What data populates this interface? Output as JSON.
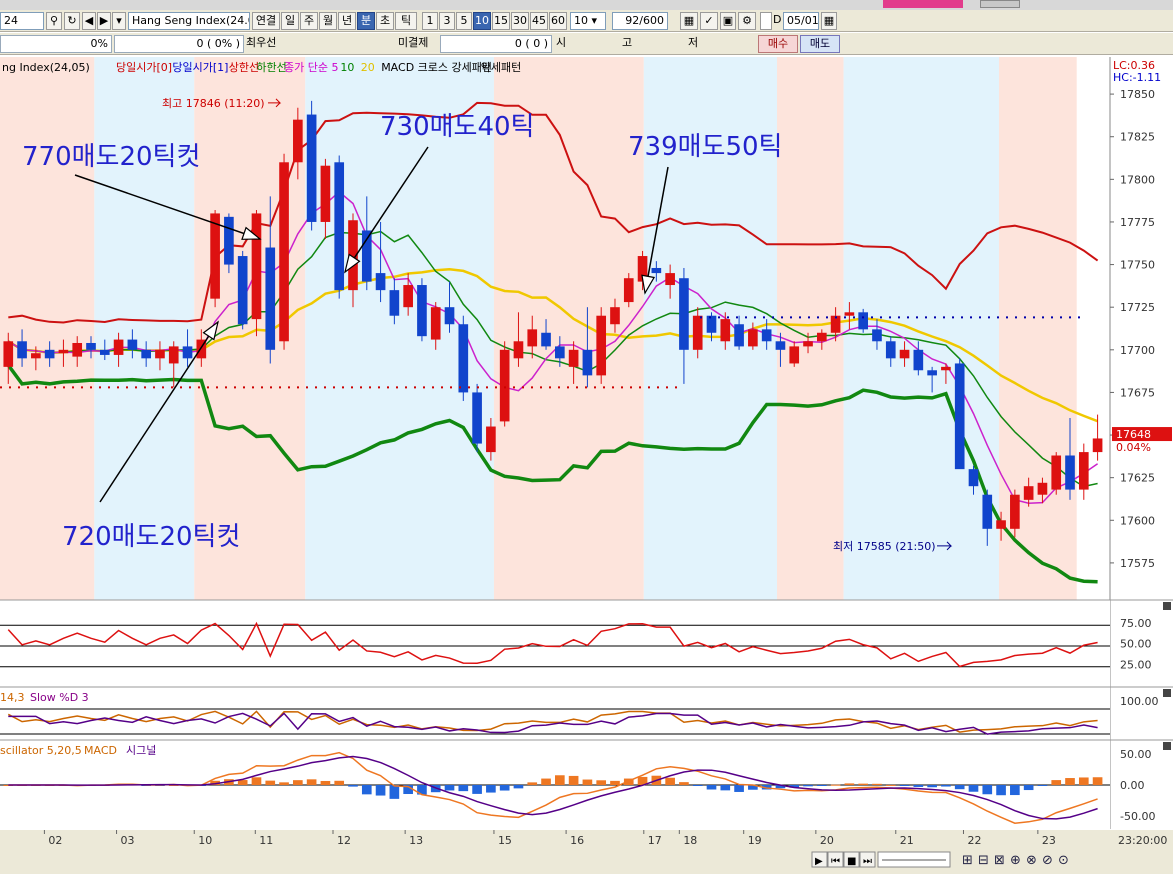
{
  "toolbar": {
    "code_value": "24",
    "symbol_value": "Hang Seng Index(24.0",
    "period_buttons": [
      "연결",
      "일",
      "주",
      "월",
      "년",
      "분",
      "초",
      "틱"
    ],
    "interval_buttons": [
      "1",
      "3",
      "5",
      "10",
      "15",
      "30",
      "45",
      "60"
    ],
    "interval_select": "10",
    "count_value": "92",
    "count_total": "/600",
    "d_label": "D",
    "date_value": "05/01"
  },
  "orderbar": {
    "pct1": "0%",
    "qty": "0",
    "pct2": "( 0% )",
    "best_label": "최우선",
    "unfilled_label": "미결제",
    "unfilled_qty": "0",
    "unfilled_paren": "( 0 )",
    "open_label": "시",
    "high_label": "고",
    "low_label": "저",
    "buy_label": "매수",
    "sell_label": "매도"
  },
  "chart_data": {
    "type": "candlestick",
    "legend": [
      {
        "text": "ng Index(24,05)",
        "color": "#000000"
      },
      {
        "text": "당일시가[0]",
        "color": "#cc0000"
      },
      {
        "text": "당일시가[1]",
        "color": "#0000cc"
      },
      {
        "text": "상한선",
        "color": "#cc0000"
      },
      {
        "text": "하한선",
        "color": "#008000"
      },
      {
        "text": "종가 단순 5",
        "color": "#cc00cc"
      },
      {
        "text": "10",
        "color": "#008000"
      },
      {
        "text": "20",
        "color": "#e0c000"
      },
      {
        "text": "MACD 크로스 강세패턴",
        "color": "#000000"
      },
      {
        "text": "약세패턴",
        "color": "#000000"
      }
    ],
    "lc_label": "LC:0.36",
    "hc_label": "HC:-1.11",
    "ylim": [
      17555,
      17870
    ],
    "yticks": [
      17850,
      17825,
      17800,
      17775,
      17750,
      17725,
      17700,
      17675,
      17650,
      17625,
      17600,
      17575
    ],
    "last_price": "17648",
    "last_change": "0.04%",
    "max_annotation": "최고 17846 (11:20)",
    "min_annotation": "최저 17585 (21:50)",
    "x_tick_labels": [
      "02",
      "03",
      "10",
      "11",
      "12",
      "13",
      "15",
      "16",
      "17",
      "18",
      "19",
      "20",
      "21",
      "22",
      "23"
    ],
    "x_end_label": "23:20:00",
    "callouts": [
      "770매도20틱컷",
      "730매도40틱",
      "739매도50틱",
      "720매도20틱컷"
    ],
    "candles": [
      {
        "o": 17690,
        "h": 17710,
        "l": 17680,
        "c": 17705
      },
      {
        "o": 17705,
        "h": 17712,
        "l": 17690,
        "c": 17695
      },
      {
        "o": 17695,
        "h": 17702,
        "l": 17688,
        "c": 17698
      },
      {
        "o": 17700,
        "h": 17705,
        "l": 17690,
        "c": 17695
      },
      {
        "o": 17698,
        "h": 17706,
        "l": 17690,
        "c": 17700
      },
      {
        "o": 17696,
        "h": 17708,
        "l": 17690,
        "c": 17704
      },
      {
        "o": 17704,
        "h": 17708,
        "l": 17695,
        "c": 17700
      },
      {
        "o": 17700,
        "h": 17706,
        "l": 17694,
        "c": 17697
      },
      {
        "o": 17697,
        "h": 17710,
        "l": 17690,
        "c": 17706
      },
      {
        "o": 17706,
        "h": 17712,
        "l": 17695,
        "c": 17700
      },
      {
        "o": 17700,
        "h": 17705,
        "l": 17690,
        "c": 17695
      },
      {
        "o": 17695,
        "h": 17705,
        "l": 17688,
        "c": 17700
      },
      {
        "o": 17692,
        "h": 17705,
        "l": 17678,
        "c": 17702
      },
      {
        "o": 17702,
        "h": 17712,
        "l": 17690,
        "c": 17695
      },
      {
        "o": 17695,
        "h": 17712,
        "l": 17690,
        "c": 17706
      },
      {
        "o": 17730,
        "h": 17782,
        "l": 17725,
        "c": 17780
      },
      {
        "o": 17778,
        "h": 17780,
        "l": 17745,
        "c": 17750
      },
      {
        "o": 17755,
        "h": 17758,
        "l": 17712,
        "c": 17715
      },
      {
        "o": 17718,
        "h": 17782,
        "l": 17708,
        "c": 17780
      },
      {
        "o": 17760,
        "h": 17790,
        "l": 17692,
        "c": 17700
      },
      {
        "o": 17705,
        "h": 17815,
        "l": 17700,
        "c": 17810
      },
      {
        "o": 17810,
        "h": 17842,
        "l": 17800,
        "c": 17835
      },
      {
        "o": 17838,
        "h": 17846,
        "l": 17770,
        "c": 17775
      },
      {
        "o": 17775,
        "h": 17812,
        "l": 17765,
        "c": 17808
      },
      {
        "o": 17810,
        "h": 17814,
        "l": 17730,
        "c": 17735
      },
      {
        "o": 17735,
        "h": 17780,
        "l": 17725,
        "c": 17776
      },
      {
        "o": 17770,
        "h": 17790,
        "l": 17735,
        "c": 17740
      },
      {
        "o": 17745,
        "h": 17775,
        "l": 17728,
        "c": 17735
      },
      {
        "o": 17735,
        "h": 17742,
        "l": 17715,
        "c": 17720
      },
      {
        "o": 17725,
        "h": 17745,
        "l": 17720,
        "c": 17738
      },
      {
        "o": 17738,
        "h": 17742,
        "l": 17705,
        "c": 17708
      },
      {
        "o": 17706,
        "h": 17728,
        "l": 17700,
        "c": 17725
      },
      {
        "o": 17725,
        "h": 17740,
        "l": 17710,
        "c": 17715
      },
      {
        "o": 17715,
        "h": 17720,
        "l": 17670,
        "c": 17675
      },
      {
        "o": 17675,
        "h": 17680,
        "l": 17640,
        "c": 17645
      },
      {
        "o": 17640,
        "h": 17660,
        "l": 17635,
        "c": 17655
      },
      {
        "o": 17658,
        "h": 17705,
        "l": 17655,
        "c": 17700
      },
      {
        "o": 17695,
        "h": 17722,
        "l": 17690,
        "c": 17705
      },
      {
        "o": 17702,
        "h": 17720,
        "l": 17695,
        "c": 17712
      },
      {
        "o": 17710,
        "h": 17718,
        "l": 17700,
        "c": 17702
      },
      {
        "o": 17702,
        "h": 17708,
        "l": 17690,
        "c": 17695
      },
      {
        "o": 17690,
        "h": 17705,
        "l": 17680,
        "c": 17700
      },
      {
        "o": 17700,
        "h": 17725,
        "l": 17678,
        "c": 17685
      },
      {
        "o": 17685,
        "h": 17725,
        "l": 17680,
        "c": 17720
      },
      {
        "o": 17715,
        "h": 17730,
        "l": 17710,
        "c": 17725
      },
      {
        "o": 17728,
        "h": 17745,
        "l": 17725,
        "c": 17742
      },
      {
        "o": 17740,
        "h": 17758,
        "l": 17735,
        "c": 17755
      },
      {
        "o": 17748,
        "h": 17752,
        "l": 17740,
        "c": 17745
      },
      {
        "o": 17738,
        "h": 17750,
        "l": 17730,
        "c": 17745
      },
      {
        "o": 17742,
        "h": 17748,
        "l": 17680,
        "c": 17700
      },
      {
        "o": 17700,
        "h": 17725,
        "l": 17695,
        "c": 17720
      },
      {
        "o": 17720,
        "h": 17722,
        "l": 17705,
        "c": 17710
      },
      {
        "o": 17705,
        "h": 17722,
        "l": 17700,
        "c": 17718
      },
      {
        "o": 17715,
        "h": 17720,
        "l": 17700,
        "c": 17702
      },
      {
        "o": 17702,
        "h": 17716,
        "l": 17700,
        "c": 17712
      },
      {
        "o": 17712,
        "h": 17718,
        "l": 17700,
        "c": 17705
      },
      {
        "o": 17705,
        "h": 17710,
        "l": 17690,
        "c": 17700
      },
      {
        "o": 17692,
        "h": 17705,
        "l": 17690,
        "c": 17702
      },
      {
        "o": 17702,
        "h": 17710,
        "l": 17698,
        "c": 17705
      },
      {
        "o": 17705,
        "h": 17712,
        "l": 17700,
        "c": 17710
      },
      {
        "o": 17710,
        "h": 17725,
        "l": 17705,
        "c": 17720
      },
      {
        "o": 17720,
        "h": 17728,
        "l": 17712,
        "c": 17722
      },
      {
        "o": 17722,
        "h": 17724,
        "l": 17710,
        "c": 17712
      },
      {
        "o": 17712,
        "h": 17718,
        "l": 17700,
        "c": 17705
      },
      {
        "o": 17705,
        "h": 17708,
        "l": 17690,
        "c": 17695
      },
      {
        "o": 17695,
        "h": 17705,
        "l": 17690,
        "c": 17700
      },
      {
        "o": 17700,
        "h": 17705,
        "l": 17685,
        "c": 17688
      },
      {
        "o": 17688,
        "h": 17690,
        "l": 17675,
        "c": 17685
      },
      {
        "o": 17688,
        "h": 17692,
        "l": 17680,
        "c": 17690
      },
      {
        "o": 17692,
        "h": 17695,
        "l": 17635,
        "c": 17630
      },
      {
        "o": 17630,
        "h": 17632,
        "l": 17615,
        "c": 17620
      },
      {
        "o": 17615,
        "h": 17618,
        "l": 17585,
        "c": 17595
      },
      {
        "o": 17595,
        "h": 17605,
        "l": 17588,
        "c": 17600
      },
      {
        "o": 17595,
        "h": 17618,
        "l": 17590,
        "c": 17615
      },
      {
        "o": 17612,
        "h": 17625,
        "l": 17608,
        "c": 17620
      },
      {
        "o": 17615,
        "h": 17625,
        "l": 17610,
        "c": 17622
      },
      {
        "o": 17618,
        "h": 17640,
        "l": 17615,
        "c": 17638
      },
      {
        "o": 17638,
        "h": 17660,
        "l": 17612,
        "c": 17618
      },
      {
        "o": 17618,
        "h": 17645,
        "l": 17612,
        "c": 17640
      },
      {
        "o": 17640,
        "h": 17662,
        "l": 17635,
        "c": 17648
      }
    ],
    "stoch_panel": {
      "ticks": [
        "75.00",
        "50.00",
        "25.00"
      ],
      "ylim": [
        0,
        100
      ]
    },
    "slow_panel": {
      "legend": [
        "14,3",
        "Slow %D 3"
      ],
      "ticks": [
        "100.00"
      ]
    },
    "macd_panel": {
      "legend": [
        "scillator 5,20,5",
        "MACD",
        "시그널"
      ],
      "ticks": [
        "50.00",
        "0.00",
        "-50.00"
      ]
    }
  },
  "colors": {
    "up": "#dd1111",
    "down": "#1144cc",
    "band_upper": "#cc1111",
    "band_lower": "#118811",
    "ma5": "#cc22cc",
    "ma10": "#118811",
    "ma20": "#f0c800",
    "bg_pink": "#fde4dc",
    "bg_blue": "#e2f3fc"
  }
}
